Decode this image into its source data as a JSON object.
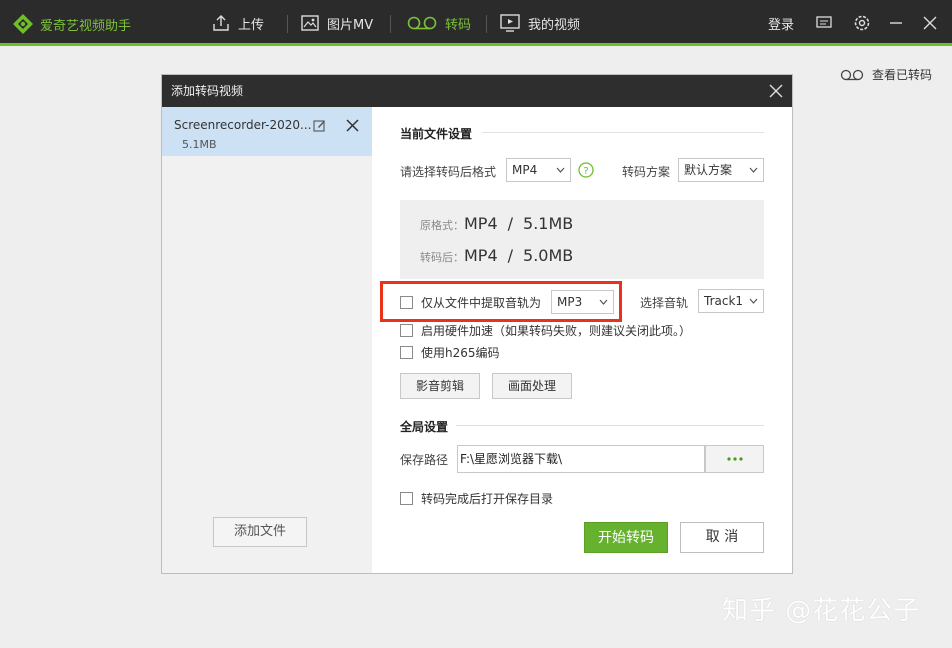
{
  "app": {
    "name": "爱奇艺视频助手",
    "brand_color": "#6fbf2a"
  },
  "nav": [
    {
      "label": "上传",
      "icon": "upload-icon"
    },
    {
      "label": "图片MV",
      "icon": "image-icon"
    },
    {
      "label": "转码",
      "icon": "transcode-icon",
      "active": true
    },
    {
      "label": "我的视频",
      "icon": "video-icon"
    }
  ],
  "topbar_right": {
    "login": "登录"
  },
  "view_transcoded": "查看已转码",
  "dialog": {
    "title": "添加转码视频",
    "file": {
      "name": "Screenrecorder-2020...",
      "size": "5.1MB"
    },
    "add_file": "添加文件",
    "current_settings": "当前文件设置",
    "format_label": "请选择转码后格式",
    "format_value": "MP4",
    "scheme_label": "转码方案",
    "scheme_value": "默认方案",
    "original_label": "原格式：",
    "original_format": "MP4",
    "original_size": "5.1MB",
    "after_label": "转码后：",
    "after_format": "MP4",
    "after_size": "5.0MB",
    "slash": "/",
    "extract_audio": {
      "label": "仅从文件中提取音轨为",
      "checked": false,
      "format": "MP3"
    },
    "audio_track_label": "选择音轨",
    "audio_track_value": "Track1",
    "hw_accel": {
      "label": "启用硬件加速（如果转码失败，则建议关闭此项。）",
      "checked": false
    },
    "h265": {
      "label": "使用h265编码",
      "checked": false
    },
    "av_edit": "影音剪辑",
    "picture_process": "画面处理",
    "global_settings": "全局设置",
    "save_path_label": "保存路径",
    "save_path_value": "F:\\星愿浏览器下载\\",
    "browse": "···",
    "open_after": {
      "label": "转码完成后打开保存目录",
      "checked": false
    },
    "start": "开始转码",
    "cancel": "取 消"
  },
  "watermark": "知乎 @花花公子"
}
